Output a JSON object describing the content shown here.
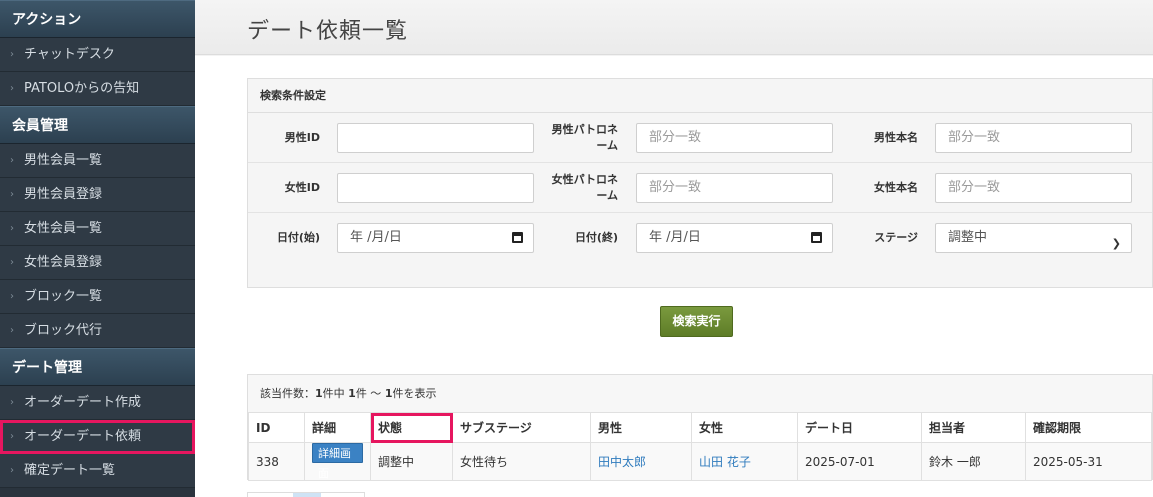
{
  "sidebar": {
    "sections": [
      {
        "title": "アクション",
        "items": [
          "チャットデスク",
          "PATOLOからの告知"
        ]
      },
      {
        "title": "会員管理",
        "items": [
          "男性会員一覧",
          "男性会員登録",
          "女性会員一覧",
          "女性会員登録",
          "ブロック一覧",
          "ブロック代行"
        ]
      },
      {
        "title": "デート管理",
        "items": [
          "オーダーデート作成",
          "オーダーデート依頼",
          "確定デート一覧"
        ]
      }
    ],
    "active_item": "オーダーデート依頼"
  },
  "page": {
    "title": "デート依頼一覧"
  },
  "search": {
    "heading": "検索条件設定",
    "male_id_label": "男性ID",
    "male_id_value": "",
    "male_patron_label_1": "男性パトロネ",
    "male_patron_label_2": "ーム",
    "male_patron_placeholder": "部分一致",
    "male_realname_label": "男性本名",
    "male_realname_placeholder": "部分一致",
    "female_id_label": "女性ID",
    "female_id_value": "",
    "female_patron_label_1": "女性パトロネ",
    "female_patron_label_2": "ーム",
    "female_patron_placeholder": "部分一致",
    "female_realname_label": "女性本名",
    "female_realname_placeholder": "部分一致",
    "date_start_label": "日付(始)",
    "date_start_value": "年 /月/日",
    "date_end_label": "日付(終)",
    "date_end_value": "年 /月/日",
    "stage_label": "ステージ",
    "stage_value": "調整中",
    "submit_label": "検索実行"
  },
  "results": {
    "count_prefix": "該当件数：",
    "count_total": "1",
    "count_mid": "件中 ",
    "count_range": "1",
    "count_suffix": "件 ～ ",
    "count_end": "1",
    "count_tail": "件を表示",
    "columns": [
      "ID",
      "詳細",
      "状態",
      "サブステージ",
      "男性",
      "女性",
      "デート日",
      "担当者",
      "確認期限"
    ],
    "rows": [
      {
        "id": "338",
        "detail": "詳細画面",
        "status": "調整中",
        "substage": "女性待ち",
        "male": "田中太郎",
        "female": "山田 花子",
        "date": "2025-07-01",
        "staff": "鈴木 一郎",
        "deadline": "2025-05-31"
      }
    ]
  },
  "icons": {
    "calendar": "calendar-icon",
    "select": "chevron-down-icon",
    "bullet": "chevron-right-icon"
  },
  "colors": {
    "highlight": "#e6165f",
    "sidebar_bg": "#2a343e",
    "button_green": "#6b8c32",
    "link": "#2f7bbd"
  }
}
